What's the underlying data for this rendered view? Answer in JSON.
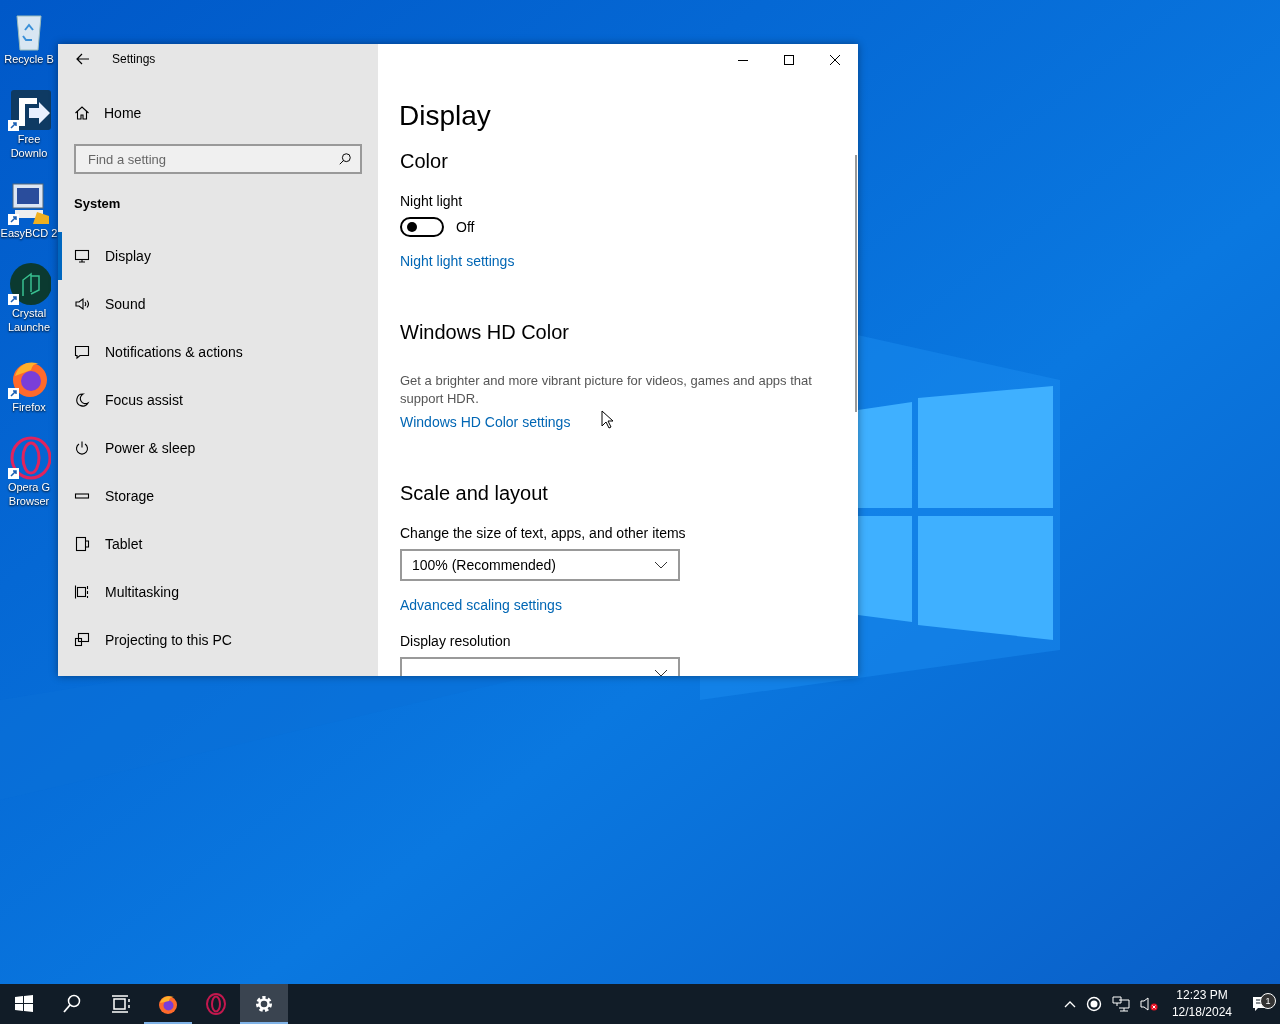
{
  "desktop": {
    "icons": [
      {
        "kind": "recycle-bin",
        "label": "Recycle B"
      },
      {
        "kind": "download",
        "label": "Free Downlo"
      },
      {
        "kind": "monitor",
        "label": "EasyBCD 2"
      },
      {
        "kind": "crystal",
        "label": "Crystal Launche"
      },
      {
        "kind": "firefox",
        "label": "Firefox"
      },
      {
        "kind": "opera",
        "label": "Opera G Browser"
      }
    ]
  },
  "window": {
    "title": "Settings",
    "sidebar": {
      "home": "Home",
      "search": {
        "placeholder": "Find a setting"
      },
      "section": "System",
      "items": [
        {
          "kind": "display",
          "label": "Display",
          "selected": true
        },
        {
          "kind": "sound",
          "label": "Sound",
          "selected": false
        },
        {
          "kind": "notifications",
          "label": "Notifications & actions",
          "selected": false
        },
        {
          "kind": "focus",
          "label": "Focus assist",
          "selected": false
        },
        {
          "kind": "power",
          "label": "Power & sleep",
          "selected": false
        },
        {
          "kind": "storage",
          "label": "Storage",
          "selected": false
        },
        {
          "kind": "tablet",
          "label": "Tablet",
          "selected": false
        },
        {
          "kind": "multitasking",
          "label": "Multitasking",
          "selected": false
        },
        {
          "kind": "projecting",
          "label": "Projecting to this PC",
          "selected": false
        }
      ]
    },
    "content": {
      "title": "Display",
      "items": [
        {
          "kind": "heading",
          "text": "Color"
        },
        {
          "kind": "label",
          "text": "Night light"
        },
        {
          "kind": "toggle",
          "on": false,
          "state_label": "Off"
        },
        {
          "kind": "link",
          "text": "Night light settings"
        },
        {
          "kind": "heading",
          "text": "Windows HD Color"
        },
        {
          "kind": "text",
          "text": "Get a brighter and more vibrant picture for videos, games and apps that support HDR."
        },
        {
          "kind": "link",
          "text": "Windows HD Color settings"
        },
        {
          "kind": "heading",
          "text": "Scale and layout"
        },
        {
          "kind": "label",
          "text": "Change the size of text, apps, and other items"
        },
        {
          "kind": "dropdown",
          "value": "100% (Recommended)"
        },
        {
          "kind": "link",
          "text": "Advanced scaling settings"
        },
        {
          "kind": "label",
          "text": "Display resolution"
        },
        {
          "kind": "dropdown"
        }
      ]
    }
  },
  "taskbar": {
    "apps": [
      {
        "kind": "start",
        "running": false,
        "selected": false
      },
      {
        "kind": "search",
        "running": false,
        "selected": false
      },
      {
        "kind": "task-view",
        "running": false,
        "selected": false
      },
      {
        "kind": "firefox",
        "running": true,
        "selected": false
      },
      {
        "kind": "opera",
        "running": false,
        "selected": false
      },
      {
        "kind": "settings",
        "running": true,
        "selected": true
      }
    ],
    "tray": {
      "volume_muted": true,
      "time": "12:23 PM",
      "date": "12/18/2024",
      "notifications": "1"
    }
  }
}
